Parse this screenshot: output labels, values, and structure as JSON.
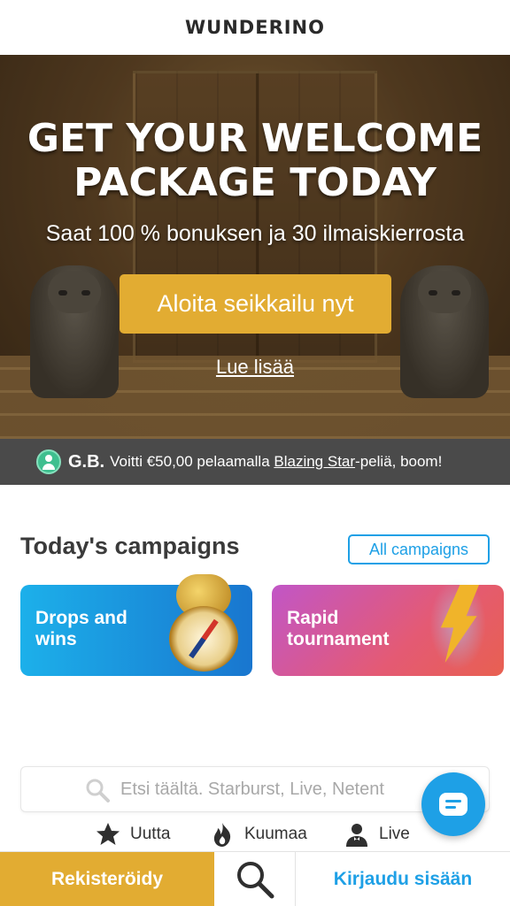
{
  "header": {
    "logo": "WUNDERINO"
  },
  "hero": {
    "title_line1": "GET YOUR WELCOME",
    "title_line2": "PACKAGE TODAY",
    "subtitle": "Saat 100 % bonuksen ja 30 ilmaiskierrosta",
    "cta_label": "Aloita seikkailu nyt",
    "read_more": "Lue lisää"
  },
  "ticker": {
    "icon": "user-circle-icon",
    "name": "G.B.",
    "msg_prefix": "Voitti €50,00 pelaamalla ",
    "game": "Blazing Star",
    "msg_suffix": "-peliä, boom!"
  },
  "campaigns": {
    "title": "Today's campaigns",
    "all_label": "All campaigns",
    "cards": [
      {
        "label": "Drops and wins",
        "icon": "compass-icon",
        "color_start": "#1cb0ea",
        "color_end": "#1976cf"
      },
      {
        "label": "Rapid tournament",
        "icon": "lightning-bolt-icon",
        "color_start": "#c156c7",
        "color_end": "#e86051"
      }
    ]
  },
  "search": {
    "placeholder": "Etsi täältä. Starburst, Live, Netent",
    "icon": "search-icon"
  },
  "quick_links": [
    {
      "label": "Uutta",
      "icon": "star-icon"
    },
    {
      "label": "Kuumaa",
      "icon": "flame-icon"
    },
    {
      "label": "Live",
      "icon": "dealer-icon"
    }
  ],
  "bottom_bar": {
    "register": "Rekisteröidy",
    "search_icon": "search-icon",
    "login": "Kirjaudu sisään"
  },
  "colors": {
    "accent": "#e2ac32",
    "link_blue": "#1ea0e6",
    "ticker_bg": "#4a4a4a"
  }
}
